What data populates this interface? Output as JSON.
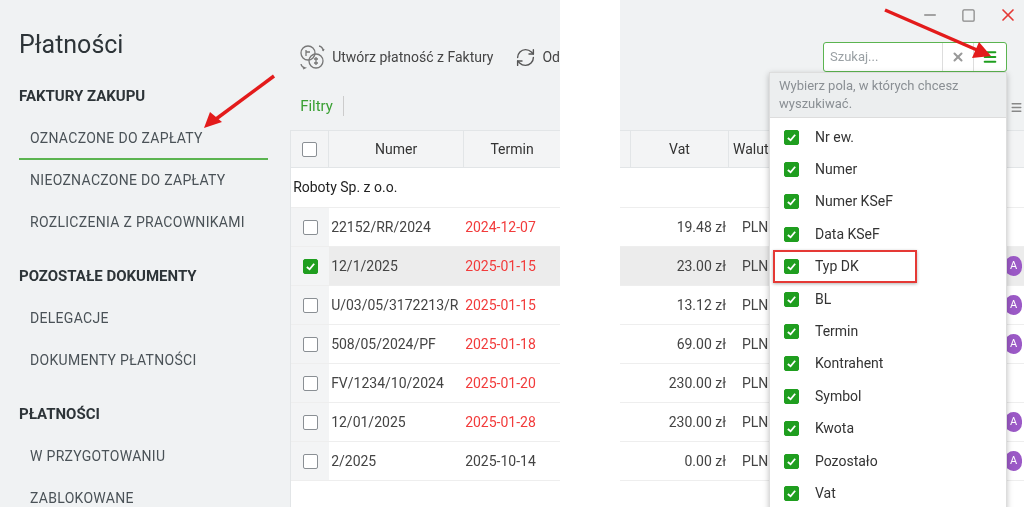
{
  "sidebar": {
    "title": "Płatności",
    "sections": [
      {
        "label": "FAKTURY ZAKUPU",
        "items": [
          {
            "label": "OZNACZONE DO ZAPŁATY",
            "selected": true
          },
          {
            "label": "NIEOZNACZONE DO ZAPŁATY",
            "selected": false
          },
          {
            "label": "ROZLICZENIA Z PRACOWNIKAMI",
            "selected": false
          }
        ]
      },
      {
        "label": "POZOSTAŁE DOKUMENTY",
        "items": [
          {
            "label": "DELEGACJE",
            "selected": false
          },
          {
            "label": "DOKUMENTY PŁATNOŚCI",
            "selected": false
          }
        ]
      },
      {
        "label": "PŁATNOŚCI",
        "items": [
          {
            "label": "W PRZYGOTOWANIU",
            "selected": false
          },
          {
            "label": "ZABLOKOWANE",
            "selected": false
          }
        ]
      }
    ]
  },
  "toolbar": [
    {
      "kind": "create",
      "label": "Utwórz płatność z Faktury"
    },
    {
      "kind": "refresh",
      "label": "Od"
    }
  ],
  "filters_tab": "Filtry",
  "table": {
    "all_checked": false,
    "columns": [
      "Numer",
      "Termin"
    ],
    "group": "Roboty Sp. z o.o.",
    "rows": [
      {
        "selected": false,
        "numer": "22152/RR/2024",
        "termin": "2024-12-07",
        "overdue": true
      },
      {
        "selected": true,
        "numer": "12/1/2025",
        "termin": "2025-01-15",
        "overdue": true
      },
      {
        "selected": false,
        "numer": "U/03/05/3172213/R",
        "termin": "2025-01-15",
        "overdue": true
      },
      {
        "selected": false,
        "numer": "508/05/2024/PF",
        "termin": "2025-01-18",
        "overdue": true
      },
      {
        "selected": false,
        "numer": "FV/1234/10/2024",
        "termin": "2025-01-20",
        "overdue": true
      },
      {
        "selected": false,
        "numer": "12/01/2025",
        "termin": "2025-01-28",
        "overdue": true
      },
      {
        "selected": false,
        "numer": "2/2025",
        "termin": "2025-10-14",
        "overdue": false
      }
    ]
  },
  "right_table": {
    "columns": [
      "Vat",
      "Walut"
    ],
    "rows": [
      {
        "selected": false,
        "vat": "19.48 zł",
        "currency": "PLN"
      },
      {
        "selected": true,
        "vat": "23.00 zł",
        "currency": "PLN",
        "avatar": "A"
      },
      {
        "selected": false,
        "vat": "13.12 zł",
        "currency": "PLN",
        "avatar": "A"
      },
      {
        "selected": false,
        "vat": "69.00 zł",
        "currency": "PLN",
        "avatar": "A"
      },
      {
        "selected": false,
        "vat": "230.00 zł",
        "currency": "PLN"
      },
      {
        "selected": false,
        "vat": "230.00 zł",
        "currency": "PLN",
        "avatar": "A"
      },
      {
        "selected": false,
        "vat": "0.00 zł",
        "currency": "PLN",
        "avatar": "A"
      }
    ]
  },
  "search": {
    "placeholder": "Szukaj..."
  },
  "search_fields_menu": {
    "hint": "Wybierz pola, w których chcesz wyszukiwać.",
    "items": [
      {
        "label": "Nr ew.",
        "checked": true,
        "highlighted": false
      },
      {
        "label": "Numer",
        "checked": true,
        "highlighted": false
      },
      {
        "label": "Numer KSeF",
        "checked": true,
        "highlighted": false
      },
      {
        "label": "Data KSeF",
        "checked": true,
        "highlighted": false
      },
      {
        "label": "Typ DK",
        "checked": true,
        "highlighted": true
      },
      {
        "label": "BL",
        "checked": true,
        "highlighted": false
      },
      {
        "label": "Termin",
        "checked": true,
        "highlighted": false
      },
      {
        "label": "Kontrahent",
        "checked": true,
        "highlighted": false
      },
      {
        "label": "Symbol",
        "checked": true,
        "highlighted": false
      },
      {
        "label": "Kwota",
        "checked": true,
        "highlighted": false
      },
      {
        "label": "Pozostało",
        "checked": true,
        "highlighted": false
      },
      {
        "label": "Vat",
        "checked": true,
        "highlighted": false
      }
    ]
  }
}
